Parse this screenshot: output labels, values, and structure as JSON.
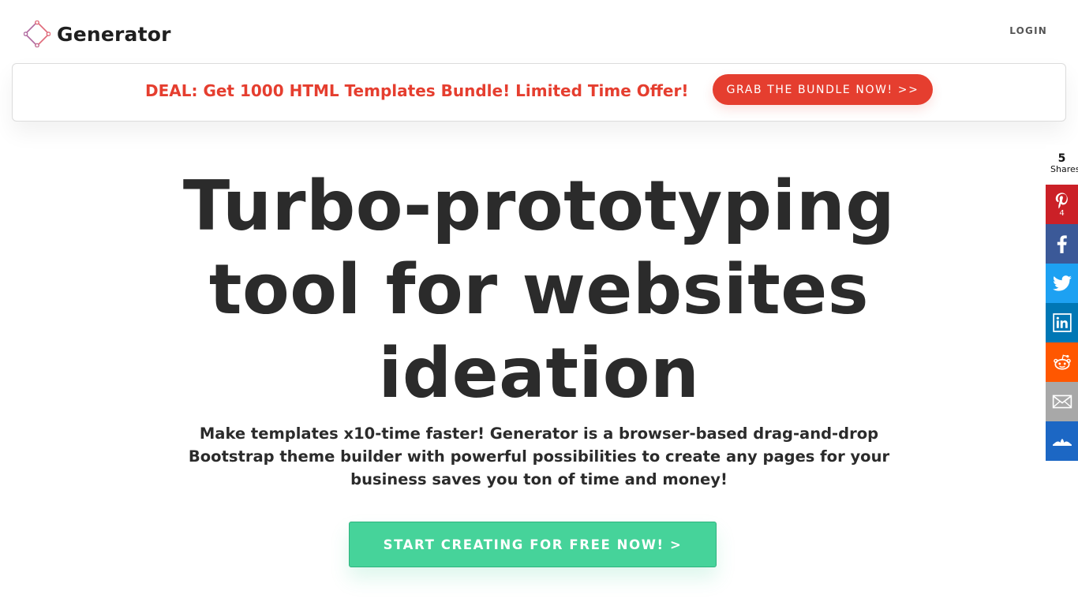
{
  "header": {
    "logo_text": "Generator",
    "login_label": "LOGIN"
  },
  "deal": {
    "text": "DEAL: Get 1000 HTML Templates Bundle! Limited Time Offer!",
    "button_label": "GRAB THE BUNDLE NOW! >>"
  },
  "hero": {
    "title": "Turbo-prototyping tool for websites ideation",
    "subtitle": "Make templates x10-time faster! Generator is a browser-based drag-and-drop Bootstrap theme builder with powerful possibilities to create any pages for your business saves you ton of time and money!",
    "cta_label": "START CREATING FOR FREE NOW! >"
  },
  "share": {
    "total": "5",
    "total_label": "Shares",
    "pinterest_count": "4",
    "networks": [
      "pinterest-icon",
      "facebook-icon",
      "twitter-icon",
      "linkedin-icon",
      "reddit-icon",
      "email-icon",
      "sumo-icon"
    ]
  },
  "colors": {
    "accent_red": "#e53e2f",
    "cta_green": "#46d39a",
    "text_dark": "#2b2b2b"
  }
}
